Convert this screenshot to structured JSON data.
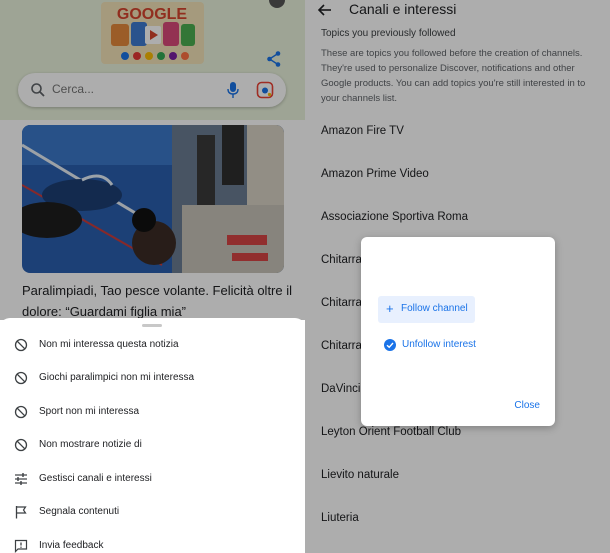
{
  "left": {
    "search": {
      "placeholder": "Cerca..."
    },
    "news": {
      "title": "Paralimpiadi, Tao pesce volante. Felicità oltre il dolore: “Guardami figlia mia”"
    },
    "sheet": {
      "items": [
        {
          "label": "Non mi interessa questa notizia",
          "icon": "block-icon"
        },
        {
          "label": "Giochi paralimpici non mi interessa",
          "icon": "block-icon"
        },
        {
          "label": "Sport non mi interessa",
          "icon": "block-icon"
        },
        {
          "label": "Non mostrare notizie di",
          "icon": "block-icon"
        },
        {
          "label": "Gestisci canali e interessi",
          "icon": "tune-icon"
        },
        {
          "label": "Segnala contenuti",
          "icon": "flag-icon"
        },
        {
          "label": "Invia feedback",
          "icon": "feedback-icon"
        }
      ]
    }
  },
  "right": {
    "header": {
      "title": "Canali e interessi"
    },
    "section": {
      "title": "Topics you previously followed",
      "description": "These are topics you followed before the creation of channels. They're used to personalize Discover, notifications and other Google products. You can add topics you're still interested in to your channels list."
    },
    "topics": [
      "Amazon Fire TV",
      "Amazon Prime Video",
      "Associazione Sportiva Roma",
      "Chitarra",
      "Chitarra",
      "Chitarra",
      "DaVinci",
      "Leyton Orient Football Club",
      "Lievito naturale",
      "Liuteria"
    ],
    "dialog": {
      "follow_label": "Follow channel",
      "unfollow_label": "Unfollow interest",
      "close_label": "Close"
    }
  },
  "colors": {
    "accent": "#1a73e8",
    "accent_bg": "#e8f0fe",
    "scrim": "rgba(0,0,0,0.32)"
  }
}
